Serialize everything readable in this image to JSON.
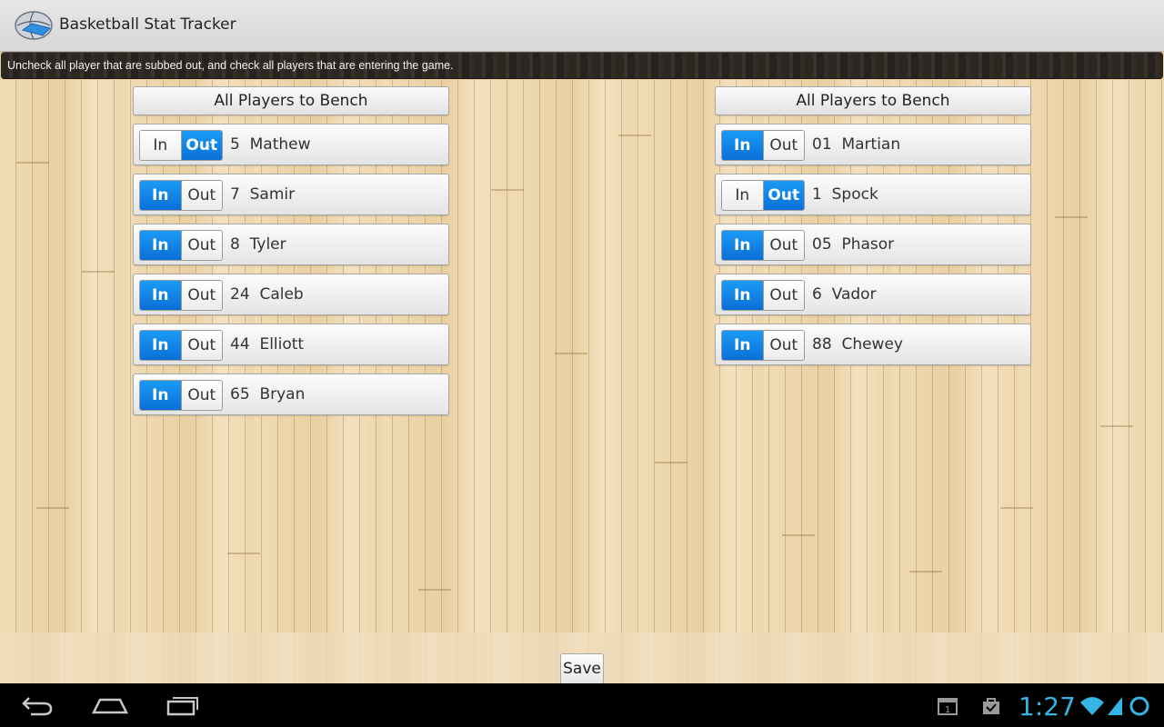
{
  "app": {
    "title": "Basketball Stat Tracker"
  },
  "instruction": "Uncheck all player that are subbed out, and check all players that are entering the game.",
  "bench_label": "All Players to Bench",
  "toggle_labels": {
    "in": "In",
    "out": "Out"
  },
  "left_team": [
    {
      "number": "5",
      "name": "Mathew",
      "state": "out"
    },
    {
      "number": "7",
      "name": "Samir",
      "state": "in"
    },
    {
      "number": "8",
      "name": "Tyler",
      "state": "in"
    },
    {
      "number": "24",
      "name": "Caleb",
      "state": "in"
    },
    {
      "number": "44",
      "name": "Elliott",
      "state": "in"
    },
    {
      "number": "65",
      "name": "Bryan",
      "state": "in"
    }
  ],
  "right_team": [
    {
      "number": "01",
      "name": "Martian",
      "state": "in"
    },
    {
      "number": "1",
      "name": "Spock",
      "state": "out"
    },
    {
      "number": "05",
      "name": "Phasor",
      "state": "in"
    },
    {
      "number": "6",
      "name": "Vador",
      "state": "in"
    },
    {
      "number": "88",
      "name": "Chewey",
      "state": "in"
    }
  ],
  "save_label": "Save",
  "status_bar": {
    "time": "1:27"
  },
  "colors": {
    "accent": "#0a6fd8",
    "clock": "#33b5e5"
  },
  "icons": [
    "back-icon",
    "home-icon",
    "recent-apps-icon",
    "calendar-icon",
    "shopping-bag-icon",
    "wifi-icon",
    "signal-ring-icon"
  ]
}
